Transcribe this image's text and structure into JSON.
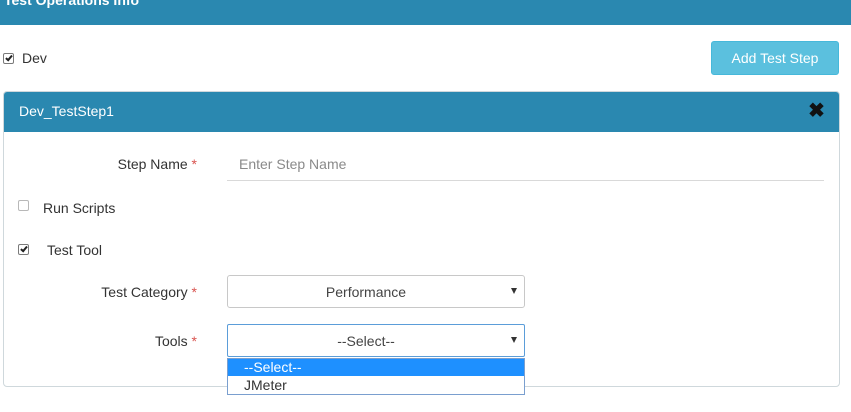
{
  "header": {
    "title": "Test Operations Info"
  },
  "dev_toggle": {
    "label": "Dev",
    "checked": true
  },
  "add_button": {
    "label": "Add Test Step"
  },
  "panel": {
    "title": "Dev_TestStep1",
    "close_icon": "close-x-icon",
    "step_name": {
      "label": "Step Name",
      "required": "*",
      "placeholder": "Enter Step Name",
      "value": ""
    },
    "run_scripts": {
      "label": "Run Scripts",
      "checked": false
    },
    "test_tool": {
      "label": "Test Tool",
      "checked": true
    },
    "test_category": {
      "label": "Test Category",
      "required": "*",
      "selected": "Performance"
    },
    "tools": {
      "label": "Tools",
      "required": "*",
      "selected": "--Select--",
      "options": [
        "--Select--",
        "JMeter"
      ]
    }
  },
  "colors": {
    "header_bg": "#2a88b0",
    "button_bg": "#5bc0de",
    "option_highlight": "#1e90ff",
    "required": "#d9534f"
  }
}
